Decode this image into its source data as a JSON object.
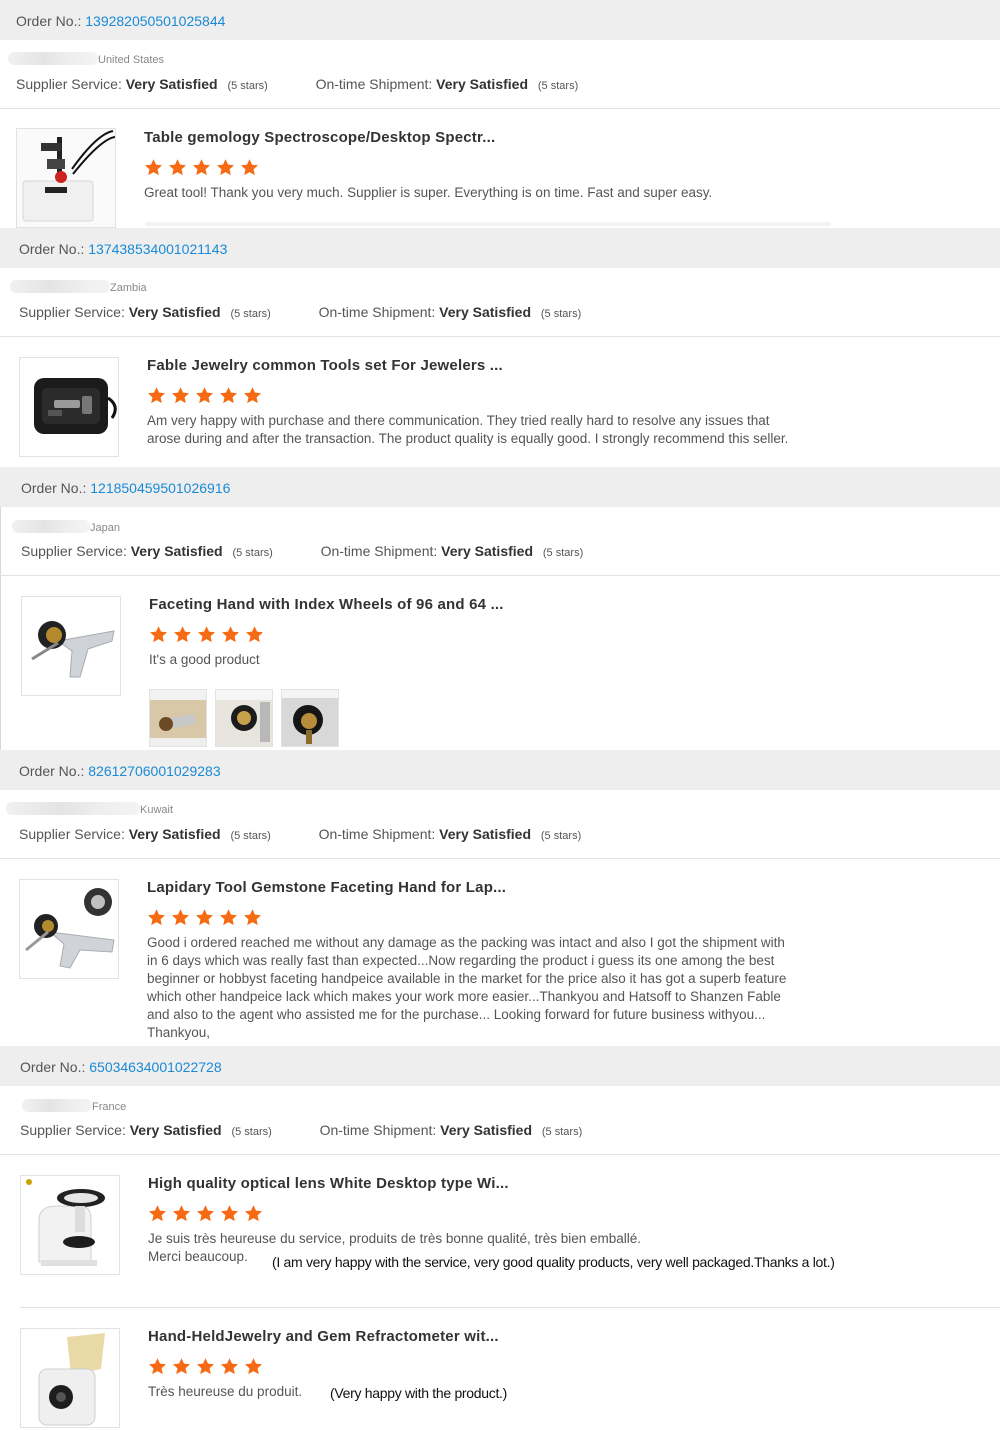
{
  "orders": [
    {
      "order_label": "Order No.:",
      "order_number": "139282050501025844",
      "country": "United States",
      "supplier_label": "Supplier Service:",
      "supplier_value": "Very Satisfied",
      "supplier_stars": "(5 stars)",
      "shipment_label": "On-time Shipment:",
      "shipment_value": "Very Satisfied",
      "shipment_stars": "(5 stars)",
      "items": [
        {
          "title": "Table gemology Spectroscope/Desktop Spectr...",
          "rating": 5,
          "review": "Great tool! Thank you very much. Supplier is super. Everything is on time. Fast and super easy."
        }
      ]
    },
    {
      "order_label": "Order No.:",
      "order_number": "137438534001021143",
      "country": "Zambia",
      "supplier_label": "Supplier Service:",
      "supplier_value": "Very Satisfied",
      "supplier_stars": "(5 stars)",
      "shipment_label": "On-time Shipment:",
      "shipment_value": "Very Satisfied",
      "shipment_stars": "(5 stars)",
      "items": [
        {
          "title": "Fable Jewelry common Tools set For Jewelers ...",
          "rating": 5,
          "review": "Am very happy with purchase and there communication. They tried really hard to resolve any issues that arose during and after the transaction. The product quality is equally good. I strongly recommend this seller."
        }
      ]
    },
    {
      "order_label": "Order No.:",
      "order_number": "121850459501026916",
      "country": "Japan",
      "supplier_label": "Supplier Service:",
      "supplier_value": "Very Satisfied",
      "supplier_stars": "(5 stars)",
      "shipment_label": "On-time Shipment:",
      "shipment_value": "Very Satisfied",
      "shipment_stars": "(5 stars)",
      "items": [
        {
          "title": "Faceting Hand with Index Wheels of 96 and 64 ...",
          "rating": 5,
          "review": "It's a good product"
        }
      ]
    },
    {
      "order_label": "Order No.:",
      "order_number": "82612706001029283",
      "country": "Kuwait",
      "supplier_label": "Supplier Service:",
      "supplier_value": "Very Satisfied",
      "supplier_stars": "(5 stars)",
      "shipment_label": "On-time Shipment:",
      "shipment_value": "Very Satisfied",
      "shipment_stars": "(5 stars)",
      "items": [
        {
          "title": "Lapidary Tool Gemstone Faceting Hand for Lap...",
          "rating": 5,
          "review": "Good i ordered reached me without any damage as the packing was intact and also I got the shipment with in 6 days which was really fast than expected...Now regarding the product i guess its one among the best beginner or hobbyst faceting handpeice available in the market for the price also it has got a superb feature which other handpeice lack which makes your work more easier...Thankyou and Hatsoff to Shanzen Fable and also to the agent who assisted me for the purchase... Looking forward for future business withyou... Thankyou,"
        }
      ]
    },
    {
      "order_label": "Order No.:",
      "order_number": "65034634001022728",
      "country": "France",
      "supplier_label": "Supplier Service:",
      "supplier_value": "Very Satisfied",
      "supplier_stars": "(5 stars)",
      "shipment_label": "On-time Shipment:",
      "shipment_value": "Very Satisfied",
      "shipment_stars": "(5 stars)",
      "items": [
        {
          "title": "High quality optical lens White Desktop type Wi...",
          "rating": 5,
          "review_line1": "Je suis très heureuse du service, produits de très bonne qualité, très bien emballé.",
          "review_line2": "Merci beaucoup.",
          "translation": "(I am very happy with the service, very good quality products, very well packaged.Thanks a lot.)"
        },
        {
          "title": "Hand-HeldJewelry and Gem Refractometer wit...",
          "rating": 5,
          "review": "Très heureuse du produit.",
          "translation": "(Very happy with the product.)"
        }
      ]
    }
  ],
  "colors": {
    "star": "#f56a12",
    "link": "#1a8ad6",
    "header_bg": "#eeeeee"
  },
  "icons": {
    "star": "star-icon"
  }
}
